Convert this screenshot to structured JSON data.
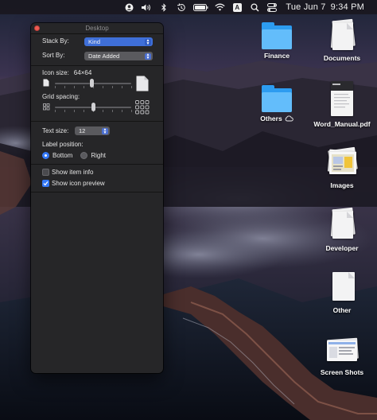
{
  "menubar": {
    "icons": [
      "user-circle-icon",
      "volume-icon",
      "bluetooth-icon",
      "time-machine-icon",
      "battery-icon",
      "wifi-icon",
      "input-source-icon",
      "search-icon",
      "control-center-icon"
    ],
    "input_source_letter": "A",
    "clock_day": "Tue Jun 7",
    "clock_time": "9:34 PM"
  },
  "window": {
    "title": "Desktop",
    "stack_by_label": "Stack By:",
    "stack_by_value": "Kind",
    "sort_by_label": "Sort By:",
    "sort_by_value": "Date Added",
    "icon_size_label": "Icon size:",
    "icon_size_value": "64×64",
    "icon_size_level": 0.48,
    "grid_spacing_label": "Grid spacing:",
    "grid_spacing_level": 0.5,
    "text_size_label": "Text size:",
    "text_size_value": "12",
    "label_position_label": "Label position:",
    "label_position_options": [
      "Bottom",
      "Right"
    ],
    "label_position_selected": "Bottom",
    "show_item_info_label": "Show item info",
    "show_item_info_checked": false,
    "show_icon_preview_label": "Show icon preview",
    "show_icon_preview_checked": true
  },
  "desktop": {
    "items": [
      {
        "name": "Finance",
        "kind": "folder"
      },
      {
        "name": "Documents",
        "kind": "stack"
      },
      {
        "name": "Others",
        "kind": "folder",
        "badge": "icloud-icon"
      },
      {
        "name": "Word_Manual.pdf",
        "kind": "pdf"
      },
      {
        "name": "Images",
        "kind": "stack"
      },
      {
        "name": "Developer",
        "kind": "stack"
      },
      {
        "name": "Other",
        "kind": "stack"
      },
      {
        "name": "Screen Shots",
        "kind": "stack"
      }
    ]
  },
  "colors": {
    "accent": "#3478f6",
    "folder_blue": "#2d9cf0",
    "close_red": "#ee5b53",
    "panel_bg": "#262628"
  }
}
